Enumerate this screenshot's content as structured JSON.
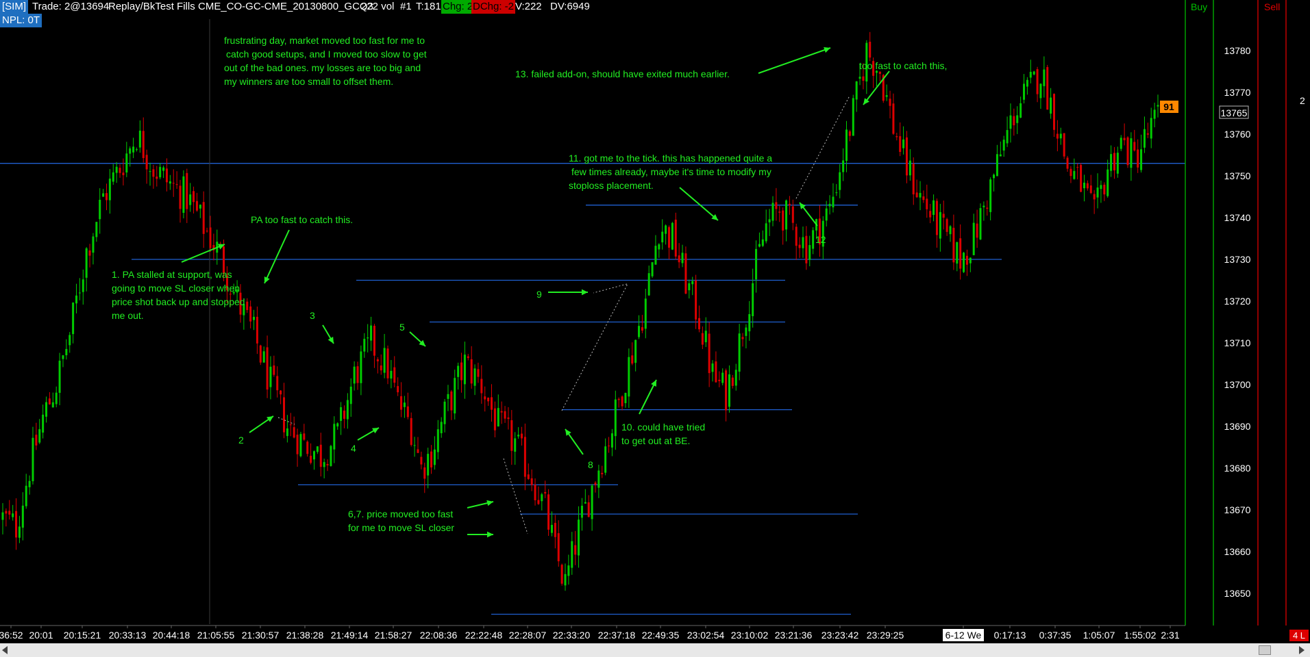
{
  "header": {
    "sim_tag": "[SIM]",
    "trade": "Trade: 2@13694",
    "fills": "Replay/BkTest Fills",
    "instrument": "CME_CO-GC-CME_20130800_GCQ3",
    "bar_type": "222 vol",
    "number": "#1",
    "tick": "T:181",
    "chg": "Chg: 2",
    "dchg": "DChg: -2",
    "volume": "V:222",
    "dv": "DV:6949",
    "npl": "NPL: 0T"
  },
  "colors": {
    "background": "#000000",
    "up_candle": "#00cc00",
    "down_candle": "#dd0000",
    "level_line": "#1f5fd0",
    "annotation": "#22ee22",
    "price_highlight": "#ff8800",
    "chg_badge": "#00aa00",
    "dchg_badge": "#cc0000",
    "sim_badge": "#1f6fc0"
  },
  "dom": {
    "buy_label": "Buy",
    "sell_label": "Sell",
    "size_value": "2",
    "corner_badge": "4 L"
  },
  "price_axis": {
    "ticks": [
      "13780",
      "13770",
      "13760",
      "13750",
      "13740",
      "13730",
      "13720",
      "13710",
      "13700",
      "13690",
      "13680",
      "13670",
      "13660",
      "13650"
    ],
    "current_price": "13765",
    "highlight_value": "91"
  },
  "time_axis": {
    "labels": [
      "36:52",
      "20:01",
      "20:15:21",
      "20:33:13",
      "20:44:18",
      "21:05:55",
      "21:30:57",
      "21:38:28",
      "21:49:14",
      "21:58:27",
      "22:08:36",
      "22:22:48",
      "22:28:07",
      "22:33:20",
      "22:37:18",
      "22:49:35",
      "23:02:54",
      "23:10:02",
      "23:21:36",
      "23:23:42",
      "23:29:25",
      "6-12 We",
      "0:17:13",
      "0:37:35",
      "1:05:07",
      "1:55:02",
      "2:31"
    ]
  },
  "annotations": {
    "summary_1": "frustrating day, market moved too fast for me to",
    "summary_2": "catch good setups, and I moved too slow to get",
    "summary_3": "out of the bad ones. my losses are too big and",
    "summary_4": "my winners are too small to offset them.",
    "n13": "13. failed add-on, should have exited much earlier.",
    "too_fast": "too fast to catch this,",
    "n11_1": "11. got me to the tick. this has happened quite a",
    "n11_2": "few times already, maybe it's time to modify my",
    "n11_3": "stoploss placement.",
    "pa_fast": "PA too fast to catch this.",
    "n1_1": "1. PA stalled at support, was",
    "n1_2": "going to move SL closer when",
    "n1_3": "price shot back up and stopped",
    "n1_4": "me out.",
    "n12": "12",
    "n9": "9",
    "n3": "3",
    "n5": "5",
    "n2": "2",
    "n4": "4",
    "n8": "8",
    "n10_1": "10. could have tried",
    "n10_2": "to get out at BE.",
    "n67_1": "6,7. price moved too fast",
    "n67_2": "for me to move SL closer"
  },
  "chart_data": {
    "type": "candlestick",
    "instrument": "CME_CO-GC-CME_20130800_GCQ3",
    "ylim": [
      13643,
      13788
    ],
    "price_ticks": [
      13780,
      13770,
      13760,
      13750,
      13740,
      13730,
      13720,
      13710,
      13700,
      13690,
      13680,
      13670,
      13660,
      13650
    ],
    "current_price": 13765,
    "horizontal_levels": [
      {
        "price": 13753
      },
      {
        "price": 13743
      },
      {
        "price": 13730
      },
      {
        "price": 13725
      },
      {
        "price": 13715
      },
      {
        "price": 13694
      },
      {
        "price": 13676
      },
      {
        "price": 13669
      },
      {
        "price": 13645
      }
    ],
    "close_path": [
      [
        0,
        13668
      ],
      [
        4,
        13666
      ],
      [
        8,
        13680
      ],
      [
        12,
        13692
      ],
      [
        16,
        13700
      ],
      [
        20,
        13712
      ],
      [
        25,
        13732
      ],
      [
        30,
        13745
      ],
      [
        35,
        13752
      ],
      [
        40,
        13760
      ],
      [
        45,
        13752
      ],
      [
        50,
        13748
      ],
      [
        55,
        13745
      ],
      [
        60,
        13738
      ],
      [
        65,
        13731
      ],
      [
        70,
        13720
      ],
      [
        75,
        13712
      ],
      [
        80,
        13700
      ],
      [
        85,
        13690
      ],
      [
        90,
        13686
      ],
      [
        95,
        13683
      ],
      [
        100,
        13688
      ],
      [
        105,
        13702
      ],
      [
        110,
        13710
      ],
      [
        115,
        13704
      ],
      [
        118,
        13696
      ],
      [
        122,
        13690
      ],
      [
        125,
        13680
      ],
      [
        128,
        13684
      ],
      [
        133,
        13695
      ],
      [
        138,
        13705
      ],
      [
        143,
        13700
      ],
      [
        148,
        13690
      ],
      [
        153,
        13686
      ],
      [
        158,
        13678
      ],
      [
        162,
        13670
      ],
      [
        165,
        13660
      ],
      [
        168,
        13652
      ],
      [
        172,
        13665
      ],
      [
        177,
        13678
      ],
      [
        182,
        13690
      ],
      [
        187,
        13705
      ],
      [
        192,
        13720
      ],
      [
        196,
        13738
      ],
      [
        200,
        13735
      ],
      [
        204,
        13725
      ],
      [
        208,
        13716
      ],
      [
        212,
        13702
      ],
      [
        216,
        13698
      ],
      [
        220,
        13710
      ],
      [
        224,
        13725
      ],
      [
        228,
        13738
      ],
      [
        232,
        13742
      ],
      [
        236,
        13738
      ],
      [
        240,
        13733
      ],
      [
        244,
        13738
      ],
      [
        247,
        13742
      ],
      [
        250,
        13752
      ],
      [
        254,
        13765
      ],
      [
        258,
        13780
      ],
      [
        262,
        13775
      ],
      [
        266,
        13762
      ],
      [
        270,
        13752
      ],
      [
        274,
        13745
      ],
      [
        278,
        13740
      ],
      [
        282,
        13735
      ],
      [
        286,
        13730
      ],
      [
        290,
        13735
      ],
      [
        294,
        13745
      ],
      [
        298,
        13755
      ],
      [
        302,
        13765
      ],
      [
        306,
        13770
      ],
      [
        310,
        13775
      ],
      [
        314,
        13765
      ],
      [
        318,
        13752
      ],
      [
        322,
        13748
      ],
      [
        326,
        13740
      ],
      [
        330,
        13752
      ],
      [
        334,
        13758
      ],
      [
        338,
        13754
      ],
      [
        342,
        13760
      ],
      [
        345,
        13764
      ]
    ]
  }
}
